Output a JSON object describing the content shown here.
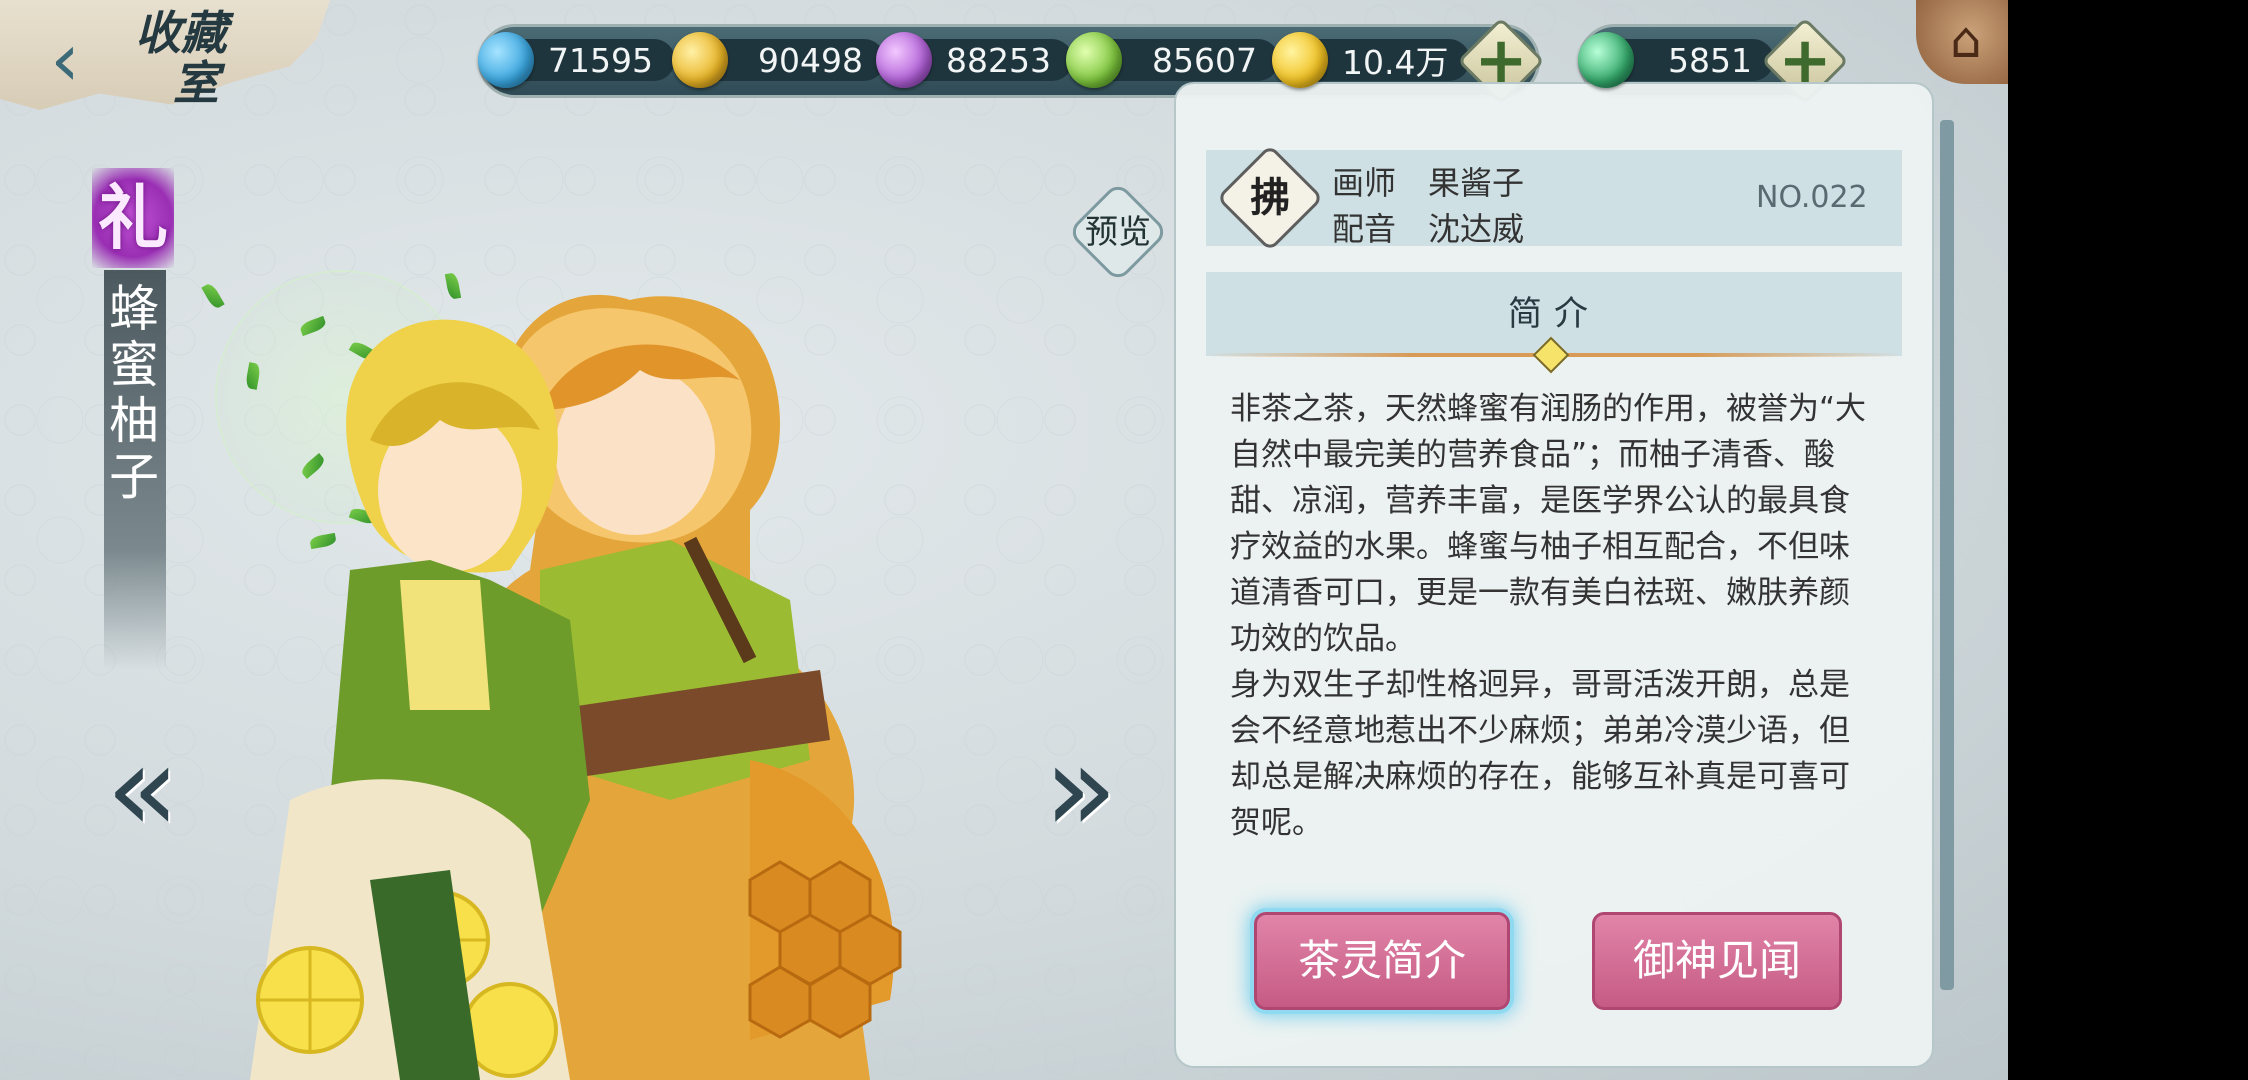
{
  "header": {
    "back_label": "‹",
    "title_line1": "收藏",
    "title_line2": "室"
  },
  "currencies": [
    {
      "icon": "blue-orb-icon",
      "color": "#3aa6df",
      "value": "71595"
    },
    {
      "icon": "gold-orb-icon",
      "color": "#e8b324",
      "value": "90498"
    },
    {
      "icon": "purple-orb-icon",
      "color": "#b060d6",
      "value": "88253"
    },
    {
      "icon": "green-orb-icon",
      "color": "#7cc43c",
      "value": "85607"
    },
    {
      "icon": "gold-coin-icon",
      "color": "#f0c020",
      "value": "10.4万"
    }
  ],
  "premium_currency": {
    "icon": "jade-icon",
    "color": "#33a86a",
    "value": "5851"
  },
  "add_label": "+",
  "home_label": "⌂",
  "character": {
    "rank": "礼",
    "name": "蜂蜜柚子"
  },
  "preview_label": "预览",
  "nav": {
    "prev": "«",
    "next": "»"
  },
  "info": {
    "seal_char": "拂",
    "artist_key": "画师",
    "artist": "果酱子",
    "voice_key": "配音",
    "voice": "沈达威",
    "number": "NO.022",
    "intro_title": "简介",
    "paragraphs": [
      "非茶之茶，天然蜂蜜有润肠的作用，被誉为“大自然中最完美的营养食品”；而柚子清香、酸甜、凉润，营养丰富，是医学界公认的最具食疗效益的水果。蜂蜜与柚子相互配合，不但味道清香可口，更是一款有美白祛斑、嫩肤养颜功效的饮品。",
      "身为双生子却性格迥异，哥哥活泼开朗，总是会不经意地惹出不少麻烦；弟弟冷漠少语，但却总是解决麻烦的存在，能够互补真是可喜可贺呢。"
    ]
  },
  "buttons": {
    "tea_intro": "茶灵简介",
    "deity_lore": "御神见闻"
  }
}
